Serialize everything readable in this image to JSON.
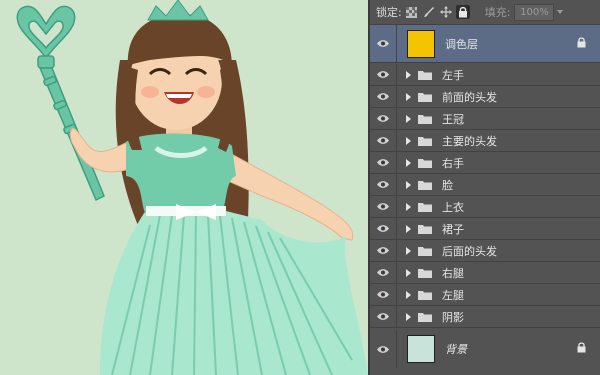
{
  "toolbar": {
    "lock_label": "锁定:",
    "fill_label": "填充:",
    "fill_value": "100%"
  },
  "layers": {
    "adjustment": {
      "name": "调色层",
      "thumb_color": "#f5c400",
      "locked": true,
      "selected": true
    },
    "groups": [
      {
        "name": "左手"
      },
      {
        "name": "前面的头发"
      },
      {
        "name": "王冠"
      },
      {
        "name": "主要的头发"
      },
      {
        "name": "右手"
      },
      {
        "name": "脸"
      },
      {
        "name": "上衣"
      },
      {
        "name": "裙子"
      },
      {
        "name": "后面的头发"
      },
      {
        "name": "右腿"
      },
      {
        "name": "左腿"
      },
      {
        "name": "阴影"
      }
    ],
    "background": {
      "name": "背景",
      "thumb_color": "#c8e4da",
      "locked": true
    }
  },
  "colors": {
    "canvas_bg": "#cfe5cb",
    "panel_bg": "#535353",
    "selected_row": "#5d6c86"
  }
}
